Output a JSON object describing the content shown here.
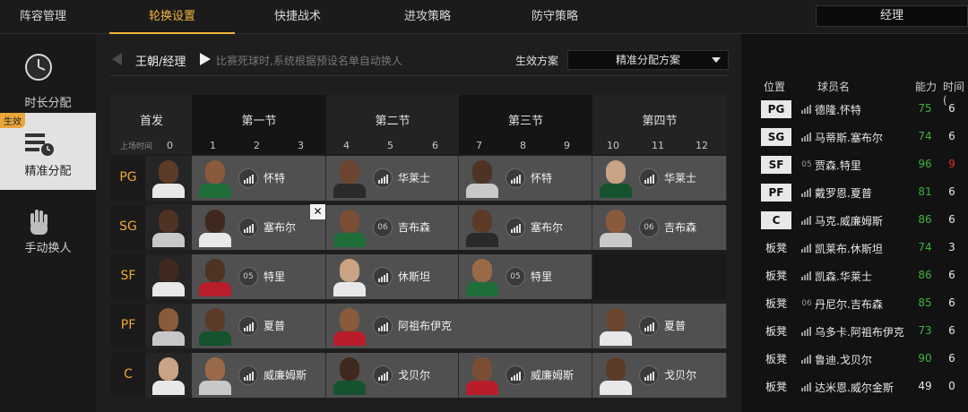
{
  "top_tabs": [
    "阵容管理",
    "轮换设置",
    "快捷战术",
    "进攻策略",
    "防守策略"
  ],
  "active_tab": "轮换设置",
  "role_select": "经理",
  "sidebar": {
    "items": [
      {
        "label": "时长分配",
        "icon": "clock-icon"
      },
      {
        "label": "精准分配",
        "icon": "precise-allocation-icon",
        "badge": "生效"
      },
      {
        "label": "手动换人",
        "icon": "hand-icon"
      }
    ]
  },
  "header": {
    "breadcrumb": "王朝/经理",
    "description": "比赛死球时,系统根据预设名单自动换人",
    "plan_label": "生效方案",
    "plan_value": "精准分配方案"
  },
  "grid": {
    "starter_header": "首发",
    "quarters": [
      "第一节",
      "第二节",
      "第三节",
      "第四节"
    ],
    "minutes_label": "上场时间",
    "minute_marks": [
      "0",
      "1",
      "2",
      "3",
      "4",
      "5",
      "6",
      "7",
      "8",
      "9",
      "10",
      "11",
      "12"
    ],
    "positions": [
      "PG",
      "SG",
      "SF",
      "PF",
      "C"
    ],
    "assignments": [
      {
        "pos": "PG",
        "segments": [
          {
            "name": "怀特",
            "slot": ""
          },
          {
            "name": "华莱士",
            "slot": ""
          },
          {
            "name": "怀特",
            "slot": ""
          },
          {
            "name": "华莱士",
            "slot": ""
          }
        ]
      },
      {
        "pos": "SG",
        "segments": [
          {
            "name": "塞布尔",
            "slot": ""
          },
          {
            "name": "吉布森",
            "slot": "06"
          },
          {
            "name": "塞布尔",
            "slot": ""
          },
          {
            "name": "吉布森",
            "slot": "06"
          }
        ]
      },
      {
        "pos": "SF",
        "segments": [
          {
            "name": "特里",
            "slot": "05"
          },
          {
            "name": "休斯坦",
            "slot": ""
          },
          {
            "name": "特里",
            "slot": "05"
          }
        ]
      },
      {
        "pos": "PF",
        "segments": [
          {
            "name": "夏普",
            "slot": ""
          },
          {
            "name": "阿祖布伊克",
            "slot": ""
          },
          {
            "name": "夏普",
            "slot": ""
          }
        ]
      },
      {
        "pos": "C",
        "segments": [
          {
            "name": "威廉姆斯",
            "slot": ""
          },
          {
            "name": "戈贝尔",
            "slot": ""
          },
          {
            "name": "威廉姆斯",
            "slot": ""
          },
          {
            "name": "戈贝尔",
            "slot": ""
          }
        ]
      }
    ]
  },
  "roster": {
    "columns": [
      "位置",
      "球员名",
      "能力",
      "时间("
    ],
    "players": [
      {
        "pos": "PG",
        "starter": true,
        "slot": "",
        "name": "德隆.怀特",
        "rating": "75",
        "rating_color": "#3fb23f",
        "time": "6"
      },
      {
        "pos": "SG",
        "starter": true,
        "slot": "",
        "name": "马蒂斯.塞布尔",
        "rating": "74",
        "rating_color": "#3fb23f",
        "time": "6"
      },
      {
        "pos": "SF",
        "starter": true,
        "slot": "05",
        "name": "贾森.特里",
        "rating": "96",
        "rating_color": "#3fb23f",
        "time": "9"
      },
      {
        "pos": "PF",
        "starter": true,
        "slot": "",
        "name": "戴罗恩.夏普",
        "rating": "81",
        "rating_color": "#3fb23f",
        "time": "6"
      },
      {
        "pos": "C",
        "starter": true,
        "slot": "",
        "name": "马克.威廉姆斯",
        "rating": "86",
        "rating_color": "#3fb23f",
        "time": "6"
      },
      {
        "pos": "板凳",
        "starter": false,
        "slot": "",
        "name": "凯莱布.休斯坦",
        "rating": "74",
        "rating_color": "#3fb23f",
        "time": "3"
      },
      {
        "pos": "板凳",
        "starter": false,
        "slot": "",
        "name": "凯森.华莱士",
        "rating": "86",
        "rating_color": "#3fb23f",
        "time": "6"
      },
      {
        "pos": "板凳",
        "starter": false,
        "slot": "06",
        "name": "丹尼尔.吉布森",
        "rating": "85",
        "rating_color": "#3fb23f",
        "time": "6"
      },
      {
        "pos": "板凳",
        "starter": false,
        "slot": "",
        "name": "乌多卡.阿祖布伊克",
        "rating": "73",
        "rating_color": "#3fb23f",
        "time": "6"
      },
      {
        "pos": "板凳",
        "starter": false,
        "slot": "",
        "name": "鲁迪.戈贝尔",
        "rating": "90",
        "rating_color": "#3fb23f",
        "time": "6"
      },
      {
        "pos": "板凳",
        "starter": false,
        "slot": "",
        "name": "达米恩.威尔金斯",
        "rating": "49",
        "rating_color": "#e8e8e8",
        "time": "0"
      }
    ]
  },
  "colors": {
    "accent": "#f1b73a",
    "position": "#f1a92f",
    "rating_high": "#3fb23f",
    "time_warning": "#e03030"
  }
}
